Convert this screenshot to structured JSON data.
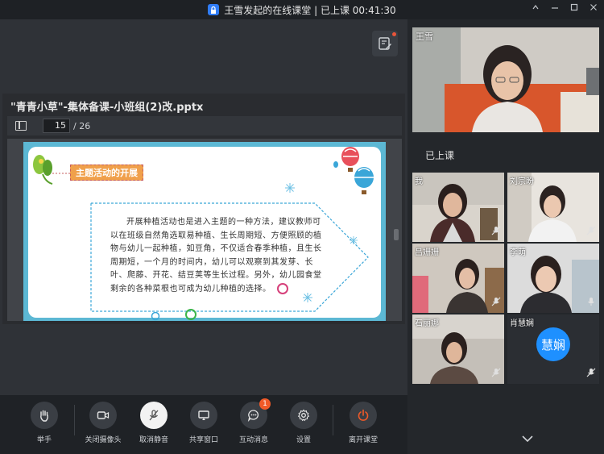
{
  "window": {
    "title": "王雪发起的在线课堂 | 已上课 00:41:30"
  },
  "presentation": {
    "file_title": "\"青青小草\"-集体备课-小班组(2)改.pptx",
    "current_page": "15",
    "total_pages": "/ 26",
    "slide": {
      "topic_tag": "主题活动的开展",
      "body": "开展种植活动也是进入主题的一种方法，建议教师可以在班级自然角选取易种植、生长周期短、方便照顾的植物与幼儿一起种植，如豆角，不仅适合春季种植，且生长周期短，一个月的时间内，幼儿可以观察到其发芽、长叶、爬藤、开花、结豆荚等生长过程。另外，幼儿园食堂剩余的各种菜根也可成为幼儿种植的选择。"
    }
  },
  "participants": {
    "host": {
      "name": "王雪"
    },
    "section_label": "已上课",
    "tiles": [
      {
        "name": "我"
      },
      {
        "name": "刘宗盼"
      },
      {
        "name": "吕姗姗"
      },
      {
        "name": "李萌"
      },
      {
        "name": "石丽娜"
      },
      {
        "name": "肖慧娴",
        "avatar_text": "慧娴"
      }
    ]
  },
  "controls": {
    "raise_hand": "举手",
    "camera": "关闭摄像头",
    "mute": "取消静音",
    "share": "共享窗口",
    "messages": "互动消息",
    "messages_badge": "1",
    "settings": "设置",
    "leave": "离开课堂"
  },
  "colors": {
    "active_speaker": "#2ecc71",
    "badge": "#f05a28",
    "leave": "#f05a28",
    "avatar": "#1e90ff"
  }
}
